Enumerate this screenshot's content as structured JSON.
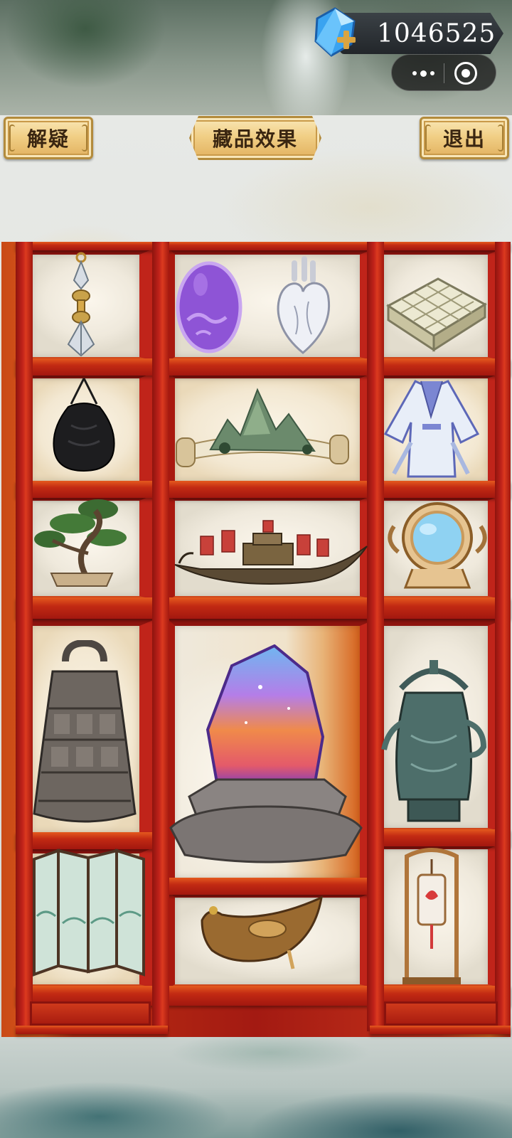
{
  "currency": {
    "amount": "1046525",
    "icon": "blue-gem-plus-icon"
  },
  "header": {
    "left_button": "解疑",
    "title": "藏品效果",
    "right_button": "退出"
  },
  "mini_program_capsule": {
    "more_icon": "more-dots-icon",
    "close_icon": "target-close-icon"
  },
  "collection": {
    "items": [
      {
        "name": "vajra-pendant-icon"
      },
      {
        "name": "purple-egg-icon"
      },
      {
        "name": "white-heart-icon"
      },
      {
        "name": "jade-grid-plate-icon"
      },
      {
        "name": "black-pouch-icon"
      },
      {
        "name": "landscape-scroll-icon"
      },
      {
        "name": "blue-robe-icon"
      },
      {
        "name": "bonsai-pine-icon"
      },
      {
        "name": "war-ship-icon"
      },
      {
        "name": "bronze-mirror-icon"
      },
      {
        "name": "bronze-bell-icon"
      },
      {
        "name": "rainbow-crystal-icon"
      },
      {
        "name": "bronze-kettle-icon"
      },
      {
        "name": "folding-screen-icon"
      },
      {
        "name": "dragon-boat-icon"
      },
      {
        "name": "hanging-lantern-icon"
      }
    ]
  },
  "colors": {
    "cabinet_red": "#b92d12",
    "gold_button": "#f1cf86",
    "button_text": "#3a2611"
  }
}
